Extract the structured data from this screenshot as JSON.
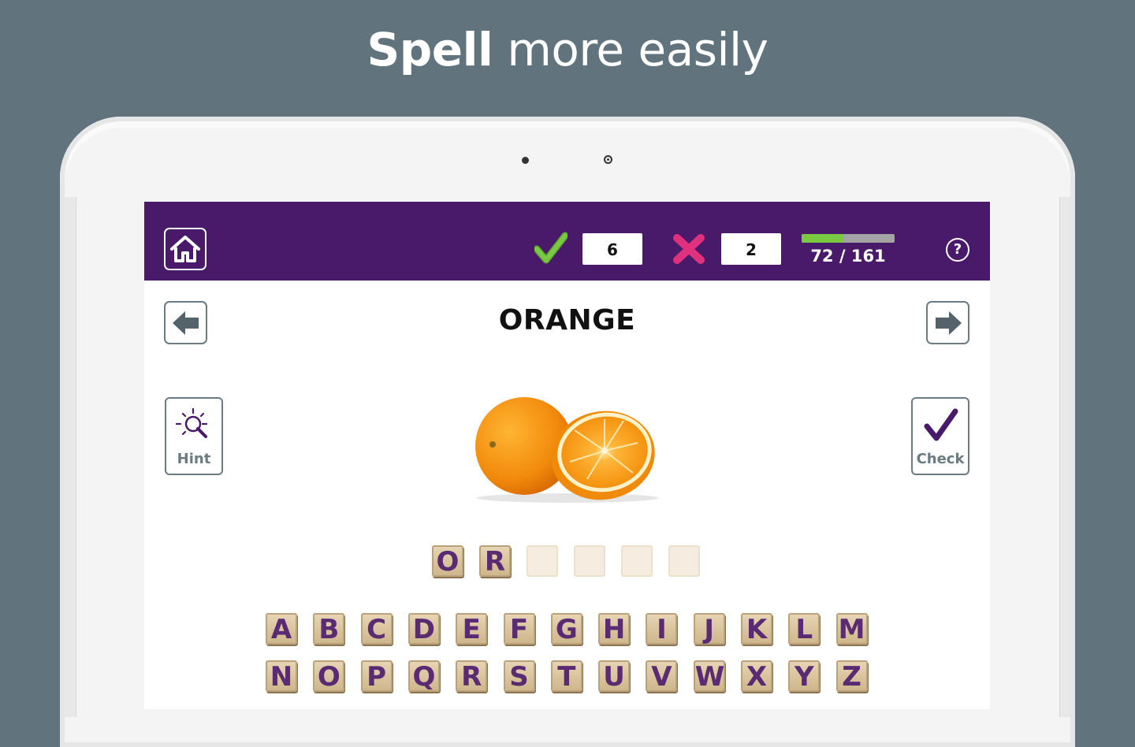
{
  "headline": {
    "bold": "Spell",
    "light": "more easily"
  },
  "topbar": {
    "correct_count": "6",
    "wrong_count": "2",
    "progress_text": "72 / 161",
    "progress_fraction": 0.447,
    "help_label": "?"
  },
  "word": "ORANGE",
  "hint_label": "Hint",
  "check_label": "Check",
  "answer_slots": [
    "O",
    "R",
    "",
    "",
    "",
    ""
  ],
  "keyboard_rows": [
    [
      "A",
      "B",
      "C",
      "D",
      "E",
      "F",
      "G",
      "H",
      "I",
      "J",
      "K",
      "L",
      "M"
    ],
    [
      "N",
      "O",
      "P",
      "Q",
      "R",
      "S",
      "T",
      "U",
      "V",
      "W",
      "X",
      "Y",
      "Z"
    ]
  ],
  "colors": {
    "background": "#61737d",
    "topbar": "#4a1a6a",
    "correct": "#7ac943",
    "wrong": "#e0317f",
    "accent": "#5a2a72",
    "progress_track": "#a4a4a4"
  },
  "icons": {
    "home": "home-icon",
    "correct": "checkmark-icon",
    "wrong": "cross-icon",
    "help": "question-circle-icon",
    "prev": "arrow-left-icon",
    "next": "arrow-right-icon",
    "hint": "lightbulb-icon",
    "check": "checkmark-icon"
  }
}
